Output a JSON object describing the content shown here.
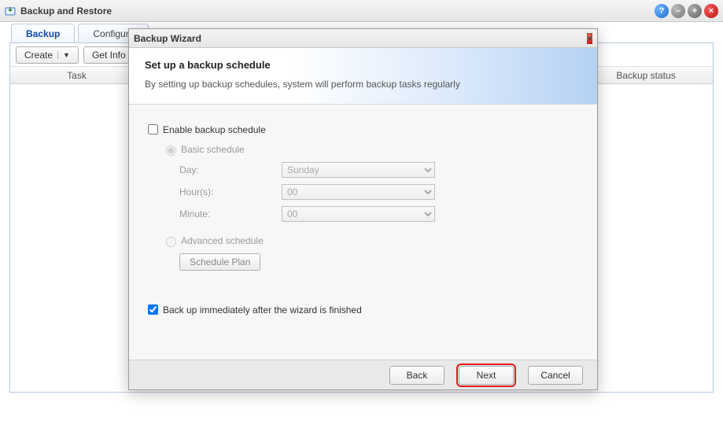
{
  "window": {
    "title": "Backup and Restore"
  },
  "tabs": {
    "backup": "Backup",
    "configure": "Configure"
  },
  "toolbar": {
    "create": "Create",
    "getinfo": "Get Info"
  },
  "columns": {
    "task": "Task",
    "status": "Backup status"
  },
  "wizard": {
    "title": "Backup Wizard",
    "heading": "Set up a backup schedule",
    "sub": "By setting up backup schedules, system will perform backup tasks regularly",
    "enable_label": "Enable backup schedule",
    "basic_label": "Basic schedule",
    "day_label": "Day:",
    "day_value": "Sunday",
    "hour_label": "Hour(s):",
    "hour_value": "00",
    "minute_label": "Minute:",
    "minute_value": "00",
    "advanced_label": "Advanced schedule",
    "schedule_plan": "Schedule Plan",
    "immediate_label": "Back up immediately after the wizard is finished",
    "buttons": {
      "back": "Back",
      "next": "Next",
      "cancel": "Cancel"
    }
  }
}
